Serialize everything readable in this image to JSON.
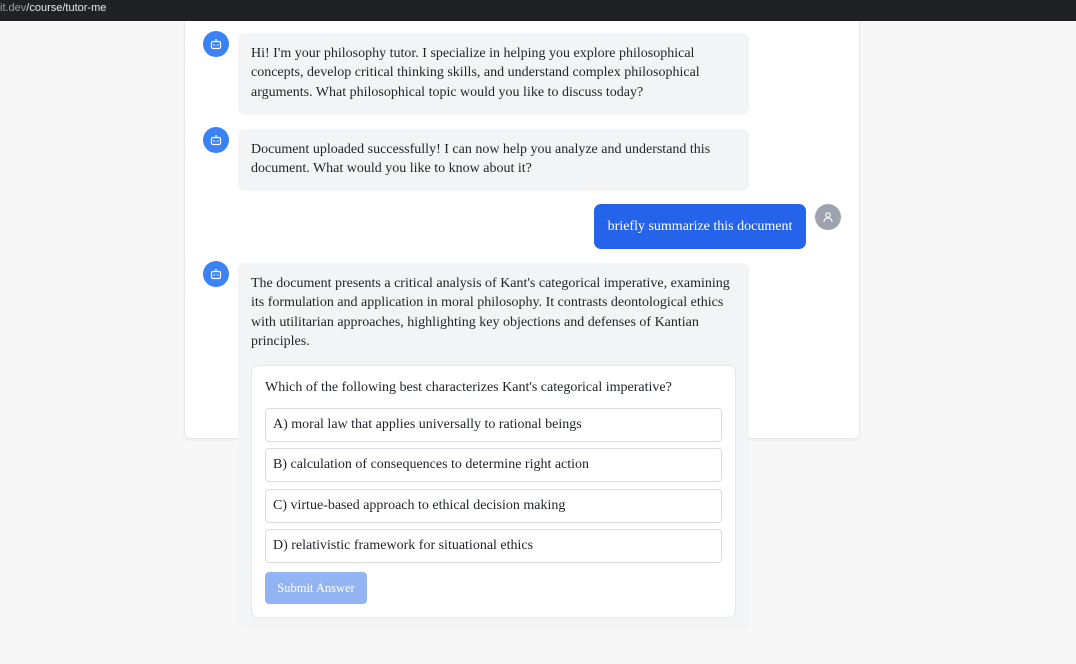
{
  "browser": {
    "url_domain": "it.dev",
    "url_path": "/course/tutor-me"
  },
  "chat": {
    "messages": [
      {
        "role": "bot",
        "text": "Hi! I'm your philosophy tutor. I specialize in helping you explore philosophical concepts, develop critical thinking skills, and understand complex philosophical arguments. What philosophical topic would you like to discuss today?"
      },
      {
        "role": "bot",
        "text": "Document uploaded successfully! I can now help you analyze and understand this document. What would you like to know about it?"
      },
      {
        "role": "user",
        "text": "briefly summarize this document"
      },
      {
        "role": "bot",
        "text": "The document presents a critical analysis of Kant's categorical imperative, examining its formulation and application in moral philosophy. It contrasts deontological ethics with utilitarian approaches, highlighting key objections and defenses of Kantian principles."
      }
    ]
  },
  "quiz": {
    "question": "Which of the following best characterizes Kant's categorical imperative?",
    "options": [
      "A) moral law that applies universally to rational beings",
      "B) calculation of consequences to determine right action",
      "C) virtue-based approach to ethical decision making",
      "D) relativistic framework for situational ethics"
    ],
    "submit_label": "Submit Answer"
  },
  "icons": {
    "bot_avatar": "robot-icon",
    "user_avatar": "user-icon"
  },
  "colors": {
    "bot_avatar": "#3b82f6",
    "user_bubble": "#2563eb",
    "user_avatar": "#9ca3af",
    "submit_disabled": "#93b4f3"
  }
}
